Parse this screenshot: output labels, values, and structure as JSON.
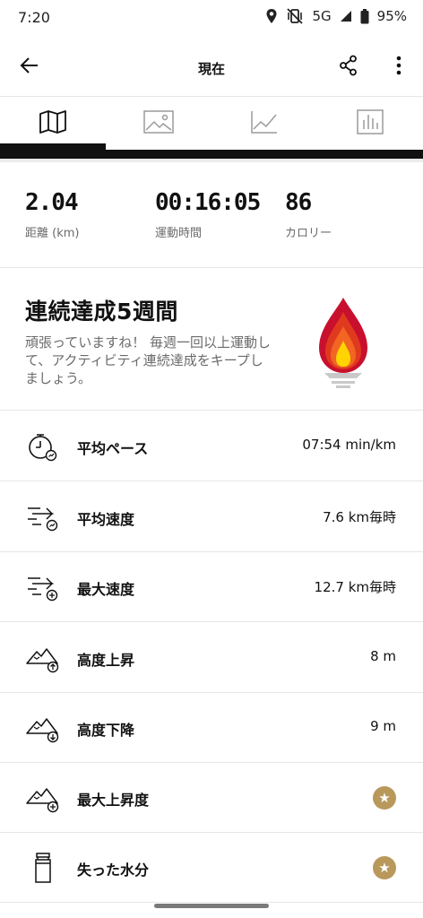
{
  "status_bar": {
    "time": "7:20",
    "network": "5G",
    "battery": "95%"
  },
  "app_bar": {
    "title": "現在"
  },
  "tabs": [
    {
      "icon": "map-icon",
      "active": true
    },
    {
      "icon": "image-icon",
      "active": false
    },
    {
      "icon": "line-chart-icon",
      "active": false
    },
    {
      "icon": "bar-chart-icon",
      "active": false
    }
  ],
  "summary": {
    "distance": {
      "value": "2.04",
      "label": "距離 (km)"
    },
    "duration": {
      "value": "00:16:05",
      "label": "運動時間"
    },
    "calories": {
      "value": "86",
      "label": "カロリー"
    }
  },
  "streak": {
    "title": "連続達成5週間",
    "description": "頑張っていますね！ 毎週一回以上運動して、アクティビティ連続達成をキープしましょう。",
    "icon": "flame-trophy-icon"
  },
  "metrics": [
    {
      "icon": "stopwatch-pace-icon",
      "label": "平均ペース",
      "value": "07:54 min/km"
    },
    {
      "icon": "speed-average-icon",
      "label": "平均速度",
      "value": "7.6 km毎時"
    },
    {
      "icon": "speed-max-icon",
      "label": "最大速度",
      "value": "12.7 km毎時"
    },
    {
      "icon": "elevation-gain-icon",
      "label": "高度上昇",
      "value": "8 m"
    },
    {
      "icon": "elevation-loss-icon",
      "label": "高度下降",
      "value": "9 m"
    },
    {
      "icon": "max-elevation-icon",
      "label": "最大上昇度",
      "value": "",
      "premium": true
    },
    {
      "icon": "water-bottle-icon",
      "label": "失った水分",
      "value": "",
      "premium": true
    }
  ],
  "colors": {
    "premium_badge": "#b9985b",
    "flame_outer": "#c8102e",
    "flame_mid": "#f26522",
    "flame_inner": "#ffd400",
    "text_secondary": "#6b6b6b"
  }
}
